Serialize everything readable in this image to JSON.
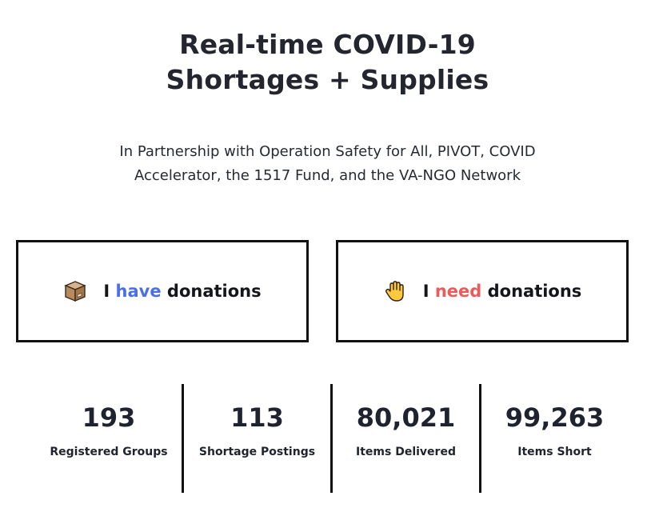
{
  "header": {
    "title_line1": "Real-time COVID-19",
    "title_line2": "Shortages + Supplies",
    "subtitle_line1": "In Partnership with Operation Safety for All, PIVOT, COVID",
    "subtitle_line2": "Accelerator, the 1517 Fund, and the VA-NGO Network"
  },
  "actions": {
    "have": {
      "icon": "package-icon",
      "prefix": "I",
      "highlight": "have",
      "suffix": "donations",
      "highlight_color": "#4a6fe8"
    },
    "need": {
      "icon": "raised-hand-icon",
      "prefix": "I",
      "highlight": "need",
      "suffix": "donations",
      "highlight_color": "#ee5a5a"
    }
  },
  "stats": [
    {
      "value": "193",
      "label": "Registered Groups"
    },
    {
      "value": "113",
      "label": "Shortage Postings"
    },
    {
      "value": "80,021",
      "label": "Items Delivered"
    },
    {
      "value": "99,263",
      "label": "Items Short"
    }
  ]
}
